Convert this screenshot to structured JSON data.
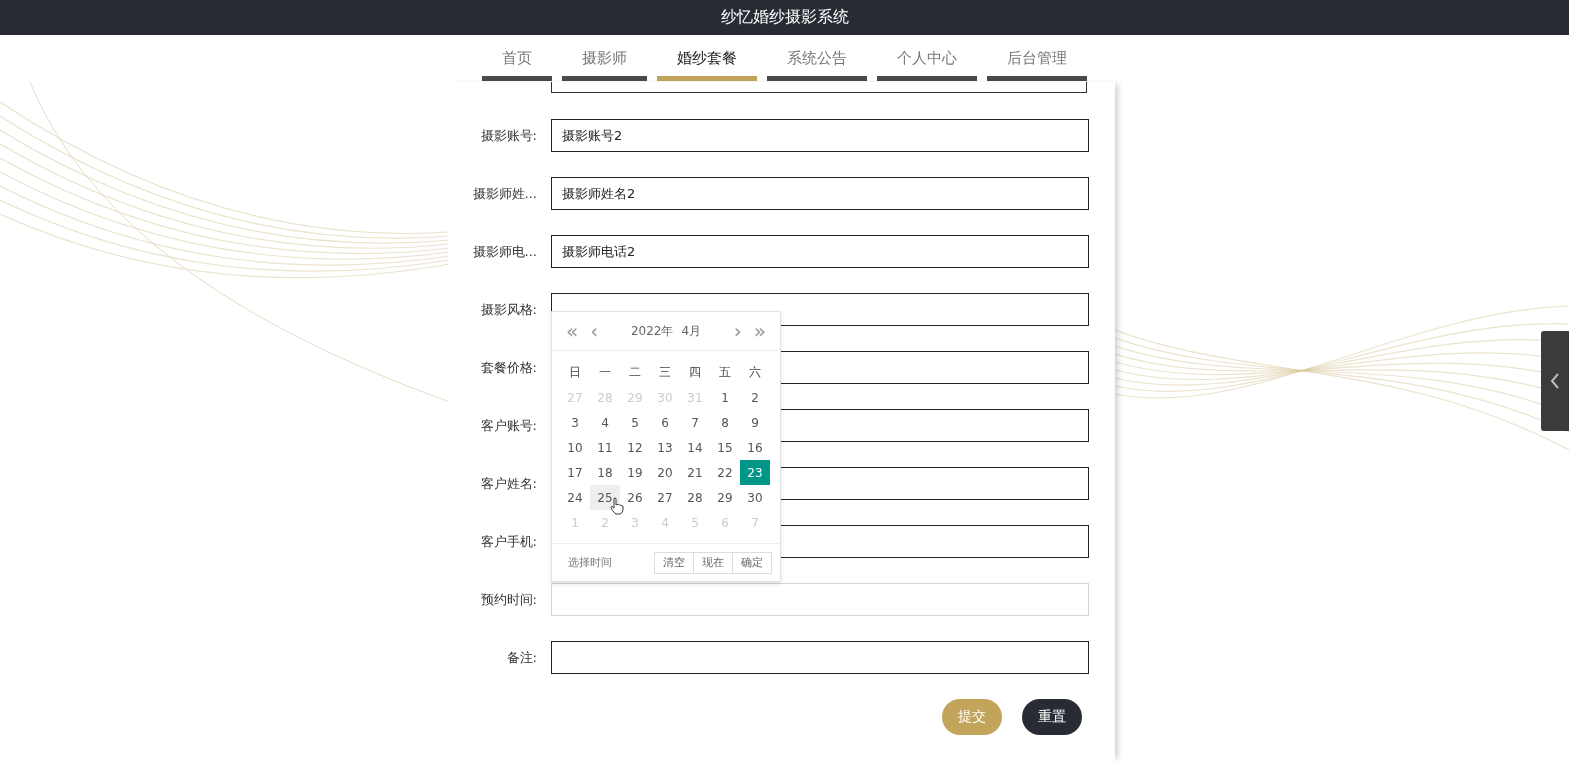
{
  "header": {
    "title": "纱忆婚纱摄影系统"
  },
  "nav": [
    {
      "label": "首页",
      "selected": false
    },
    {
      "label": "摄影师",
      "selected": false
    },
    {
      "label": "婚纱套餐",
      "selected": true
    },
    {
      "label": "系统公告",
      "selected": false
    },
    {
      "label": "个人中心",
      "selected": false
    },
    {
      "label": "后台管理",
      "selected": false
    }
  ],
  "form": {
    "fields": [
      {
        "label": "摄影账号:",
        "value": "摄影账号2"
      },
      {
        "label": "摄影师姓...",
        "value": "摄影师姓名2"
      },
      {
        "label": "摄影师电...",
        "value": "摄影师电话2"
      },
      {
        "label": "摄影风格:"
      },
      {
        "label": "套餐价格:"
      },
      {
        "label": "客户账号:"
      },
      {
        "label": "客户姓名:"
      },
      {
        "label": "客户手机:"
      },
      {
        "label": "预约时间:",
        "focused": true
      },
      {
        "label": "备注:"
      }
    ],
    "buttons": [
      {
        "label": "提交",
        "kind": "primary"
      },
      {
        "label": "重置",
        "kind": "secondary"
      }
    ]
  },
  "datepicker": {
    "prev_year": "«",
    "prev_month": "‹",
    "year": "2022年",
    "month": "4月",
    "next_month": "›",
    "next_year": "»",
    "weekdays": [
      "日",
      "一",
      "二",
      "三",
      "四",
      "五",
      "六"
    ],
    "days": [
      {
        "label": "27",
        "muted": true,
        "selected": false,
        "hovered": false
      },
      {
        "label": "28",
        "muted": true,
        "selected": false,
        "hovered": false
      },
      {
        "label": "29",
        "muted": true,
        "selected": false,
        "hovered": false
      },
      {
        "label": "30",
        "muted": true,
        "selected": false,
        "hovered": false
      },
      {
        "label": "31",
        "muted": true,
        "selected": false,
        "hovered": false
      },
      {
        "label": "1",
        "muted": false,
        "selected": false,
        "hovered": false
      },
      {
        "label": "2",
        "muted": false,
        "selected": false,
        "hovered": false
      },
      {
        "label": "3",
        "muted": false,
        "selected": false,
        "hovered": false
      },
      {
        "label": "4",
        "muted": false,
        "selected": false,
        "hovered": false
      },
      {
        "label": "5",
        "muted": false,
        "selected": false,
        "hovered": false
      },
      {
        "label": "6",
        "muted": false,
        "selected": false,
        "hovered": false
      },
      {
        "label": "7",
        "muted": false,
        "selected": false,
        "hovered": false
      },
      {
        "label": "8",
        "muted": false,
        "selected": false,
        "hovered": false
      },
      {
        "label": "9",
        "muted": false,
        "selected": false,
        "hovered": false
      },
      {
        "label": "10",
        "muted": false,
        "selected": false,
        "hovered": false
      },
      {
        "label": "11",
        "muted": false,
        "selected": false,
        "hovered": false
      },
      {
        "label": "12",
        "muted": false,
        "selected": false,
        "hovered": false
      },
      {
        "label": "13",
        "muted": false,
        "selected": false,
        "hovered": false
      },
      {
        "label": "14",
        "muted": false,
        "selected": false,
        "hovered": false
      },
      {
        "label": "15",
        "muted": false,
        "selected": false,
        "hovered": false
      },
      {
        "label": "16",
        "muted": false,
        "selected": false,
        "hovered": false
      },
      {
        "label": "17",
        "muted": false,
        "selected": false,
        "hovered": false
      },
      {
        "label": "18",
        "muted": false,
        "selected": false,
        "hovered": false
      },
      {
        "label": "19",
        "muted": false,
        "selected": false,
        "hovered": false
      },
      {
        "label": "20",
        "muted": false,
        "selected": false,
        "hovered": false
      },
      {
        "label": "21",
        "muted": false,
        "selected": false,
        "hovered": false
      },
      {
        "label": "22",
        "muted": false,
        "selected": false,
        "hovered": false
      },
      {
        "label": "23",
        "muted": false,
        "selected": true,
        "hovered": false
      },
      {
        "label": "24",
        "muted": false,
        "selected": false,
        "hovered": false
      },
      {
        "label": "25",
        "muted": false,
        "selected": false,
        "hovered": true
      },
      {
        "label": "26",
        "muted": false,
        "selected": false,
        "hovered": false
      },
      {
        "label": "27",
        "muted": false,
        "selected": false,
        "hovered": false
      },
      {
        "label": "28",
        "muted": false,
        "selected": false,
        "hovered": false
      },
      {
        "label": "29",
        "muted": false,
        "selected": false,
        "hovered": false
      },
      {
        "label": "30",
        "muted": false,
        "selected": false,
        "hovered": false
      },
      {
        "label": "1",
        "muted": true,
        "selected": false,
        "hovered": false
      },
      {
        "label": "2",
        "muted": true,
        "selected": false,
        "hovered": false
      },
      {
        "label": "3",
        "muted": true,
        "selected": false,
        "hovered": false
      },
      {
        "label": "4",
        "muted": true,
        "selected": false,
        "hovered": false
      },
      {
        "label": "5",
        "muted": true,
        "selected": false,
        "hovered": false
      },
      {
        "label": "6",
        "muted": true,
        "selected": false,
        "hovered": false
      },
      {
        "label": "7",
        "muted": true,
        "selected": false,
        "hovered": false
      }
    ],
    "footer_label": "选择时间",
    "buttons": [
      "清空",
      "现在",
      "确定"
    ]
  }
}
